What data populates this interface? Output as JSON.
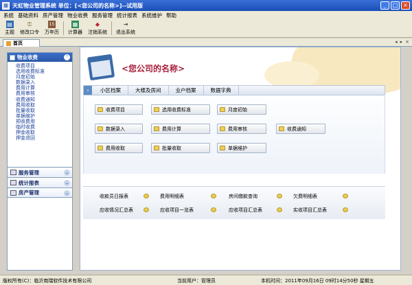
{
  "window": {
    "title": "天虹物业管理系统    单位：[<您公司的名称>]--试用版"
  },
  "menu": [
    "系统",
    "基础资料",
    "房产管理",
    "物业收费",
    "服务管理",
    "统计报表",
    "系统维护",
    "帮助"
  ],
  "toolbar": [
    {
      "label": "主题",
      "icon": "theme-icon"
    },
    {
      "label": "修改口令",
      "icon": "key-icon"
    },
    {
      "label": "万年历",
      "icon": "calendar-icon"
    },
    {
      "label": "计算器",
      "icon": "calculator-icon"
    },
    {
      "label": "注销系统",
      "icon": "logout-icon"
    },
    {
      "label": "退出系统",
      "icon": "exit-icon"
    }
  ],
  "tabs": {
    "home": "首页"
  },
  "sidebar": {
    "header": "物业收费",
    "items": [
      "收费项目",
      "选用收费标准",
      "月度初始",
      "数据录入",
      "费用计算",
      "费用审核",
      "收费通知",
      "费用收取",
      "批量收取",
      "单据维护",
      "预收费用",
      "临时收费",
      "押金收取",
      "押金退回"
    ],
    "sections": [
      "服务管理",
      "统计报表",
      "房产管理"
    ]
  },
  "main": {
    "company": "<您公司的名称>",
    "navtabs": [
      "小区档案",
      "大楼及房间",
      "业户档案",
      "数据字典"
    ],
    "functions": [
      "收费项目",
      "选用收费标准",
      "月度初始",
      "数据录入",
      "费用计算",
      "费用审核",
      "收费通知",
      "费用收取",
      "批量收取",
      "单据维护"
    ],
    "reports": [
      "收款员日报表",
      "费用明细表",
      "房间缴款查询",
      "欠费明细表",
      "应收情况汇总表",
      "应收项目一览表",
      "应收项目汇总表",
      "实收项目汇总表"
    ]
  },
  "status": {
    "copyright": "版权所有(C)：临沂南瑞软件技术有限公司",
    "user": "当前用户：管理员",
    "time": "本机时间：2011年09月16日 09时14分50秒 星期五"
  },
  "colors": {
    "titlebar": "#1a4fb8",
    "company_text": "#a8203c",
    "sidebar_header": "#2a58a8"
  }
}
